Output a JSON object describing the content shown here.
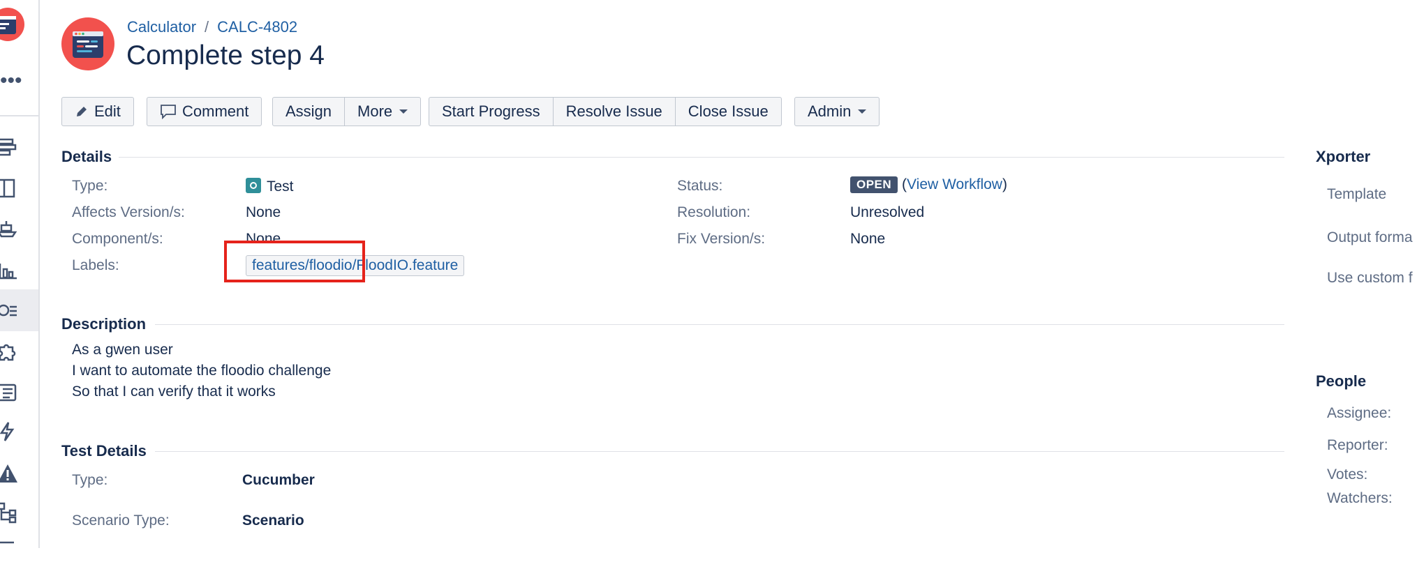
{
  "breadcrumb": {
    "project": "Calculator",
    "separator": "/",
    "issue_key": "CALC-4802"
  },
  "issue": {
    "title": "Complete step 4"
  },
  "toolbar": {
    "edit": "Edit",
    "comment": "Comment",
    "assign": "Assign",
    "more": "More",
    "start_progress": "Start Progress",
    "resolve_issue": "Resolve Issue",
    "close_issue": "Close Issue",
    "admin": "Admin"
  },
  "details": {
    "heading": "Details",
    "type_label": "Type:",
    "type_value": "Test",
    "affects_label": "Affects Version/s:",
    "affects_value": "None",
    "component_label": "Component/s:",
    "component_value": "None",
    "labels_label": "Labels:",
    "labels_value": "features/floodio/FloodIO.feature",
    "status_label": "Status:",
    "status_value": "OPEN",
    "view_workflow": "View Workflow",
    "paren_open": "(",
    "paren_close": ")",
    "resolution_label": "Resolution:",
    "resolution_value": "Unresolved",
    "fix_label": "Fix Version/s:",
    "fix_value": "None"
  },
  "description": {
    "heading": "Description",
    "lines": [
      "As a gwen user",
      "I want to automate the floodio challenge",
      "So that I can verify that it works"
    ]
  },
  "test_details": {
    "heading": "Test Details",
    "type_label": "Type:",
    "type_value": "Cucumber",
    "scenario_label": "Scenario Type:",
    "scenario_value": "Scenario"
  },
  "xporter": {
    "heading": "Xporter",
    "template": "Template",
    "output_format": "Output forma",
    "use_custom": "Use custom f"
  },
  "people": {
    "heading": "People",
    "assignee": "Assignee:",
    "reporter": "Reporter:",
    "votes": "Votes:",
    "watchers": "Watchers:"
  },
  "colors": {
    "link": "#1f5fa3",
    "status_bg": "#42526e",
    "highlight": "#e5231b",
    "avatar_red": "#f2514d",
    "avatar_navy": "#2c3e6b"
  }
}
